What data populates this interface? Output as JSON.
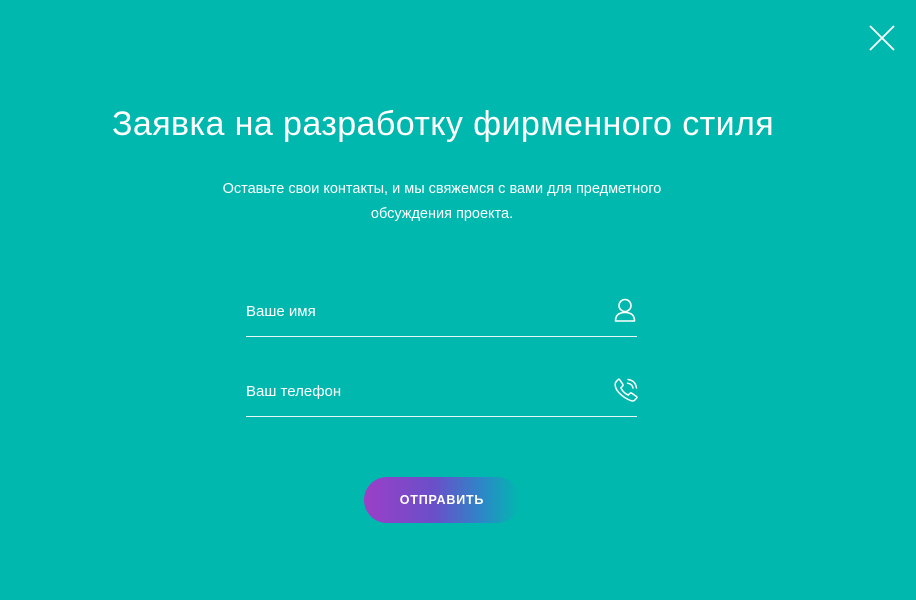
{
  "modal": {
    "title": "Заявка на разработку фирменного стиля",
    "subtitle": "Оставьте свои контакты, и мы свяжемся с вами для предметного обсуждения проекта.",
    "close_icon": "close-icon"
  },
  "form": {
    "name_field": {
      "placeholder": "Ваше имя",
      "value": "",
      "icon": "user-icon"
    },
    "phone_field": {
      "placeholder": "Ваш телефон",
      "value": "",
      "icon": "phone-icon"
    },
    "submit_label": "ОТПРАВИТЬ"
  },
  "colors": {
    "background": "#00b8ae",
    "text": "#ffffff",
    "button_gradient_start": "#9b3fc7",
    "button_gradient_end": "#2e86c8"
  }
}
